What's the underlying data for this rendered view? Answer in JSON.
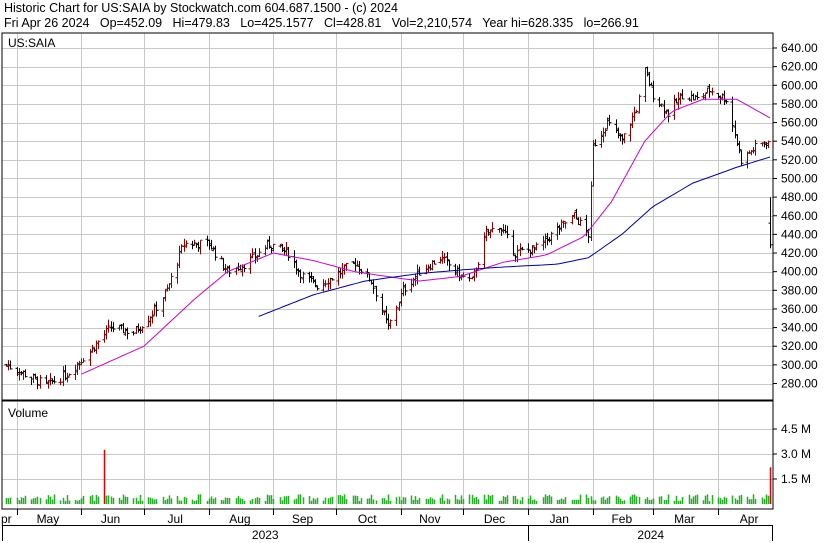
{
  "header": {
    "line1": "Historic Chart for US:SAIA by Stockwatch.com 604.687.1500 - (c) 2024",
    "line2": "Fri Apr 26 2024   Op=452.09   Hi=479.83   Lo=425.1577   Cl=428.81   Vol=2,210,574   Year hi=628.335   lo=266.91"
  },
  "price_panel": {
    "ticker_label": "US:SAIA"
  },
  "volume_panel": {
    "label": "Volume"
  },
  "colors": {
    "price_bar_up": "#8b0000",
    "price_bar_down": "#000000",
    "ma_short": "#d000d0",
    "ma_long": "#0000a0",
    "volume": "#22b022",
    "volume_spike": "#e00000",
    "grid": "#c8c8c8",
    "frame": "#000000"
  },
  "chart_data": {
    "type": "line",
    "title": "Historic Chart for US:SAIA",
    "price_axis": {
      "ylim": [
        260,
        645
      ],
      "ticks": [
        280,
        300,
        320,
        340,
        360,
        380,
        400,
        420,
        440,
        460,
        480,
        500,
        520,
        540,
        560,
        580,
        600,
        620,
        640
      ]
    },
    "volume_axis": {
      "ticks": [
        1.5,
        3.0,
        4.5
      ],
      "tick_labels": [
        "1.5 M",
        "3.0 M",
        "4.5 M"
      ]
    },
    "x_axis": {
      "months": [
        "Apr",
        "May",
        "Jun",
        "Jul",
        "Aug",
        "Sep",
        "Oct",
        "Nov",
        "Dec",
        "Jan",
        "Feb",
        "Mar",
        "Apr"
      ],
      "month_labels": [
        "pr",
        "May",
        "Jun",
        "Jul",
        "Aug",
        "Sep",
        "Oct",
        "Nov",
        "Dec",
        "Jan",
        "Feb",
        "Mar",
        "Apr"
      ],
      "years": [
        "2023",
        "2024"
      ]
    },
    "price_anchors": [
      [
        "2023-04-26",
        300
      ],
      [
        "2023-05-05",
        290
      ],
      [
        "2023-05-15",
        278
      ],
      [
        "2023-05-25",
        290
      ],
      [
        "2023-06-05",
        315
      ],
      [
        "2023-06-15",
        340
      ],
      [
        "2023-06-26",
        335
      ],
      [
        "2023-07-05",
        355
      ],
      [
        "2023-07-12",
        380
      ],
      [
        "2023-07-20",
        430
      ],
      [
        "2023-08-01",
        430
      ],
      [
        "2023-08-10",
        400
      ],
      [
        "2023-08-20",
        410
      ],
      [
        "2023-08-30",
        430
      ],
      [
        "2023-09-08",
        420
      ],
      [
        "2023-09-15",
        395
      ],
      [
        "2023-09-22",
        385
      ],
      [
        "2023-09-30",
        395
      ],
      [
        "2023-10-10",
        410
      ],
      [
        "2023-10-18",
        390
      ],
      [
        "2023-10-26",
        340
      ],
      [
        "2023-11-02",
        380
      ],
      [
        "2023-11-10",
        400
      ],
      [
        "2023-11-20",
        415
      ],
      [
        "2023-11-30",
        395
      ],
      [
        "2023-12-05",
        390
      ],
      [
        "2023-12-12",
        440
      ],
      [
        "2023-12-18",
        450
      ],
      [
        "2023-12-26",
        420
      ],
      [
        "2024-01-05",
        425
      ],
      [
        "2024-01-15",
        445
      ],
      [
        "2024-01-23",
        460
      ],
      [
        "2024-01-30",
        440
      ],
      [
        "2024-02-01",
        535
      ],
      [
        "2024-02-08",
        560
      ],
      [
        "2024-02-15",
        540
      ],
      [
        "2024-02-22",
        575
      ],
      [
        "2024-02-26",
        615
      ],
      [
        "2024-03-01",
        590
      ],
      [
        "2024-03-08",
        570
      ],
      [
        "2024-03-15",
        590
      ],
      [
        "2024-03-22",
        585
      ],
      [
        "2024-03-28",
        595
      ],
      [
        "2024-04-05",
        585
      ],
      [
        "2024-04-12",
        520
      ],
      [
        "2024-04-20",
        535
      ],
      [
        "2024-04-25",
        540
      ],
      [
        "2024-04-26",
        428.81
      ]
    ],
    "ma_short_anchors": [
      [
        "2023-06-01",
        290
      ],
      [
        "2023-07-01",
        320
      ],
      [
        "2023-07-25",
        370
      ],
      [
        "2023-08-10",
        400
      ],
      [
        "2023-09-01",
        420
      ],
      [
        "2023-09-20",
        412
      ],
      [
        "2023-10-10",
        400
      ],
      [
        "2023-10-25",
        395
      ],
      [
        "2023-11-10",
        390
      ],
      [
        "2023-11-30",
        395
      ],
      [
        "2023-12-20",
        410
      ],
      [
        "2024-01-10",
        418
      ],
      [
        "2024-01-28",
        438
      ],
      [
        "2024-02-10",
        475
      ],
      [
        "2024-02-26",
        540
      ],
      [
        "2024-03-10",
        572
      ],
      [
        "2024-03-25",
        585
      ],
      [
        "2024-04-10",
        585
      ],
      [
        "2024-04-26",
        565
      ]
    ],
    "ma_long_anchors": [
      [
        "2023-08-25",
        352
      ],
      [
        "2023-09-20",
        375
      ],
      [
        "2023-10-15",
        390
      ],
      [
        "2023-11-10",
        398
      ],
      [
        "2023-12-01",
        402
      ],
      [
        "2023-12-20",
        405
      ],
      [
        "2024-01-15",
        408
      ],
      [
        "2024-01-30",
        415
      ],
      [
        "2024-02-15",
        440
      ],
      [
        "2024-03-01",
        470
      ],
      [
        "2024-03-20",
        495
      ],
      [
        "2024-04-10",
        512
      ],
      [
        "2024-04-26",
        523
      ]
    ],
    "volume_spikes": [
      [
        "2023-06-12",
        3.25
      ],
      [
        "2024-04-26",
        2.2
      ]
    ],
    "volume_baseline_m": 0.45
  }
}
